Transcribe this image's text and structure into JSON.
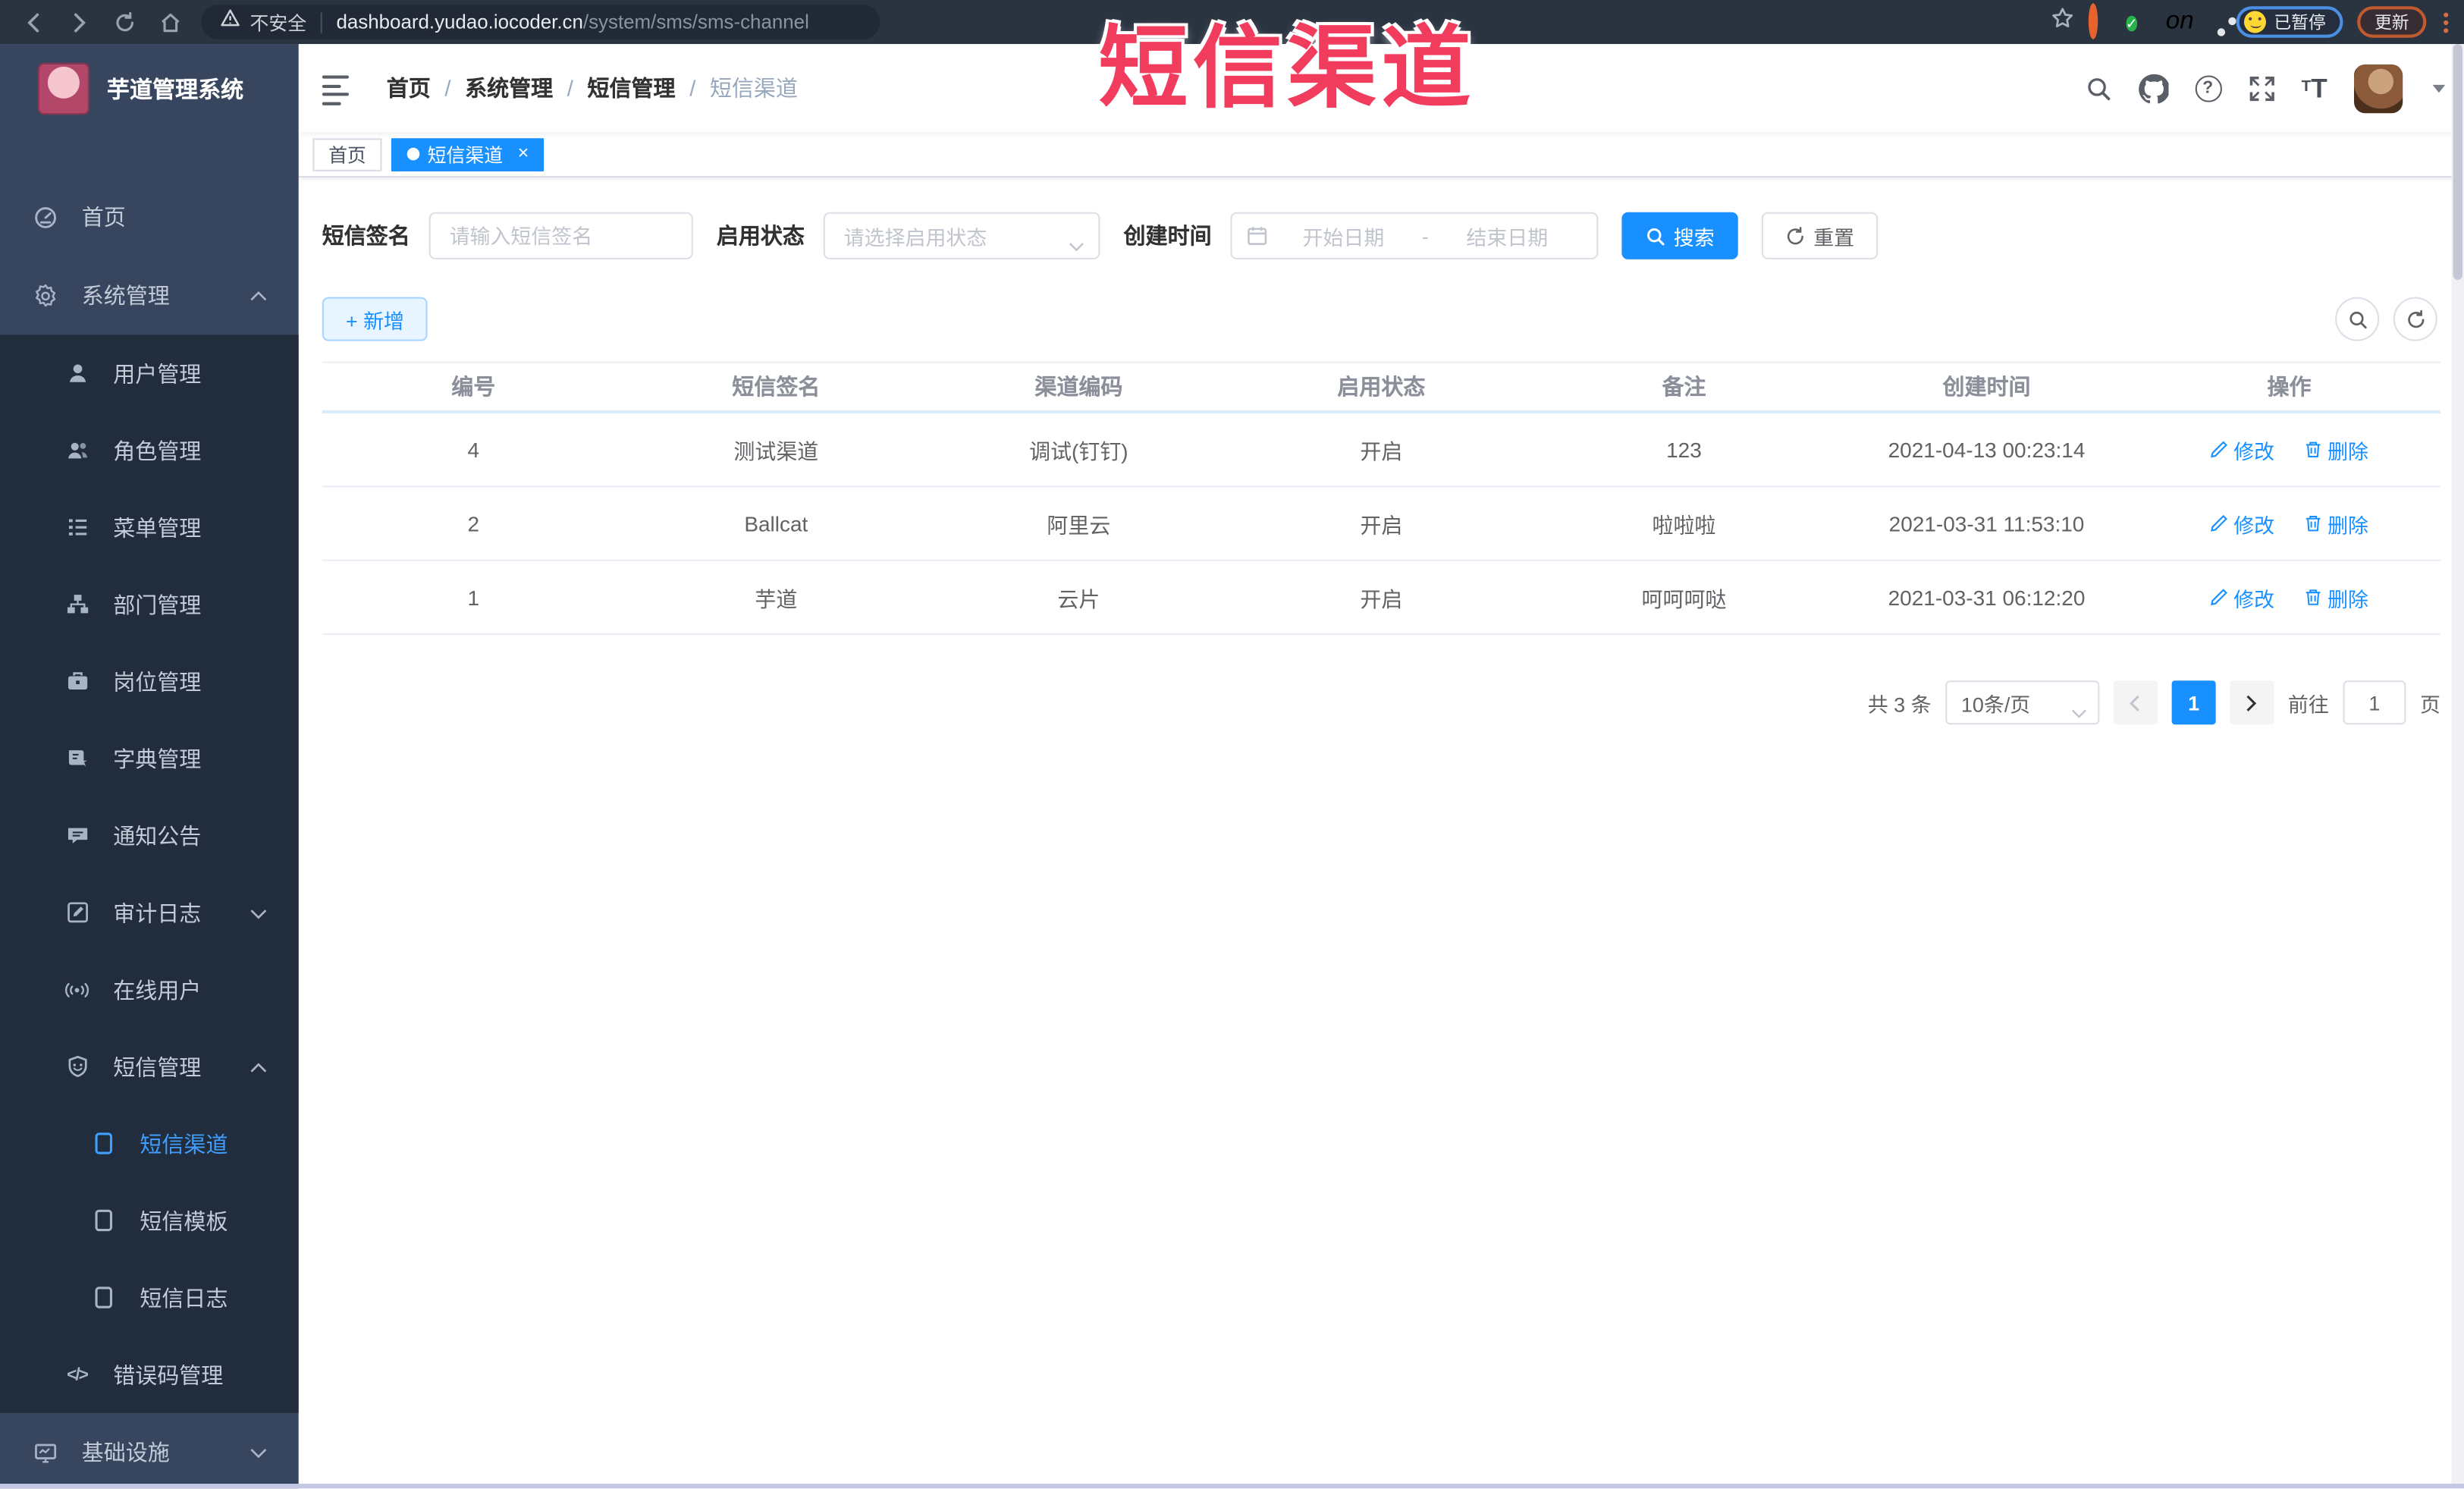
{
  "annotation": {
    "text": "短信渠道",
    "color": "#f23c5e"
  },
  "browser": {
    "security": "不安全",
    "url_host": "dashboard.yudao.iocoder.cn",
    "url_path": "/system/sms/sms-channel",
    "paused": "已暂停",
    "update": "更新",
    "ext_badge": "on"
  },
  "sidebar": {
    "title": "芋道管理系统",
    "items": [
      {
        "label": "首页"
      },
      {
        "label": "系统管理"
      },
      {
        "label": "用户管理"
      },
      {
        "label": "角色管理"
      },
      {
        "label": "菜单管理"
      },
      {
        "label": "部门管理"
      },
      {
        "label": "岗位管理"
      },
      {
        "label": "字典管理"
      },
      {
        "label": "通知公告"
      },
      {
        "label": "审计日志"
      },
      {
        "label": "在线用户"
      },
      {
        "label": "短信管理"
      },
      {
        "label": "短信渠道"
      },
      {
        "label": "短信模板"
      },
      {
        "label": "短信日志"
      },
      {
        "label": "错误码管理"
      },
      {
        "label": "基础设施"
      }
    ],
    "code_glyph": "</>"
  },
  "header": {
    "breadcrumb": [
      "首页",
      "系统管理",
      "短信管理",
      "短信渠道"
    ],
    "separator": "/"
  },
  "tags": {
    "home": "首页",
    "active": "短信渠道",
    "close": "×"
  },
  "filter": {
    "sign_label": "短信签名",
    "sign_placeholder": "请输入短信签名",
    "status_label": "启用状态",
    "status_placeholder": "请选择启用状态",
    "time_label": "创建时间",
    "date_start": "开始日期",
    "date_separator": "-",
    "date_end": "结束日期",
    "search": "搜索",
    "reset": "重置"
  },
  "toolbar": {
    "add": "+ 新增"
  },
  "table": {
    "headers": [
      "编号",
      "短信签名",
      "渠道编码",
      "启用状态",
      "备注",
      "创建时间",
      "操作"
    ],
    "rows": [
      {
        "id": "4",
        "sign": "测试渠道",
        "code": "调试(钉钉)",
        "status": "开启",
        "remark": "123",
        "created": "2021-04-13 00:23:14",
        "edit": "修改",
        "delete": "删除"
      },
      {
        "id": "2",
        "sign": "Ballcat",
        "code": "阿里云",
        "status": "开启",
        "remark": "啦啦啦",
        "created": "2021-03-31 11:53:10",
        "edit": "修改",
        "delete": "删除"
      },
      {
        "id": "1",
        "sign": "芋道",
        "code": "云片",
        "status": "开启",
        "remark": "呵呵呵哒",
        "created": "2021-03-31 06:12:20",
        "edit": "修改",
        "delete": "删除"
      }
    ]
  },
  "pagination": {
    "total": "共 3 条",
    "page_size": "10条/页",
    "page": "1",
    "goto_label": "前往",
    "goto_value": "1",
    "page_unit": "页"
  },
  "colors": {
    "accent": "#1890ff",
    "menu_active": "#409eff",
    "sidebar_bg": "#38455e",
    "submenu_bg": "#212c3d",
    "browser_bg": "#2a3340"
  }
}
